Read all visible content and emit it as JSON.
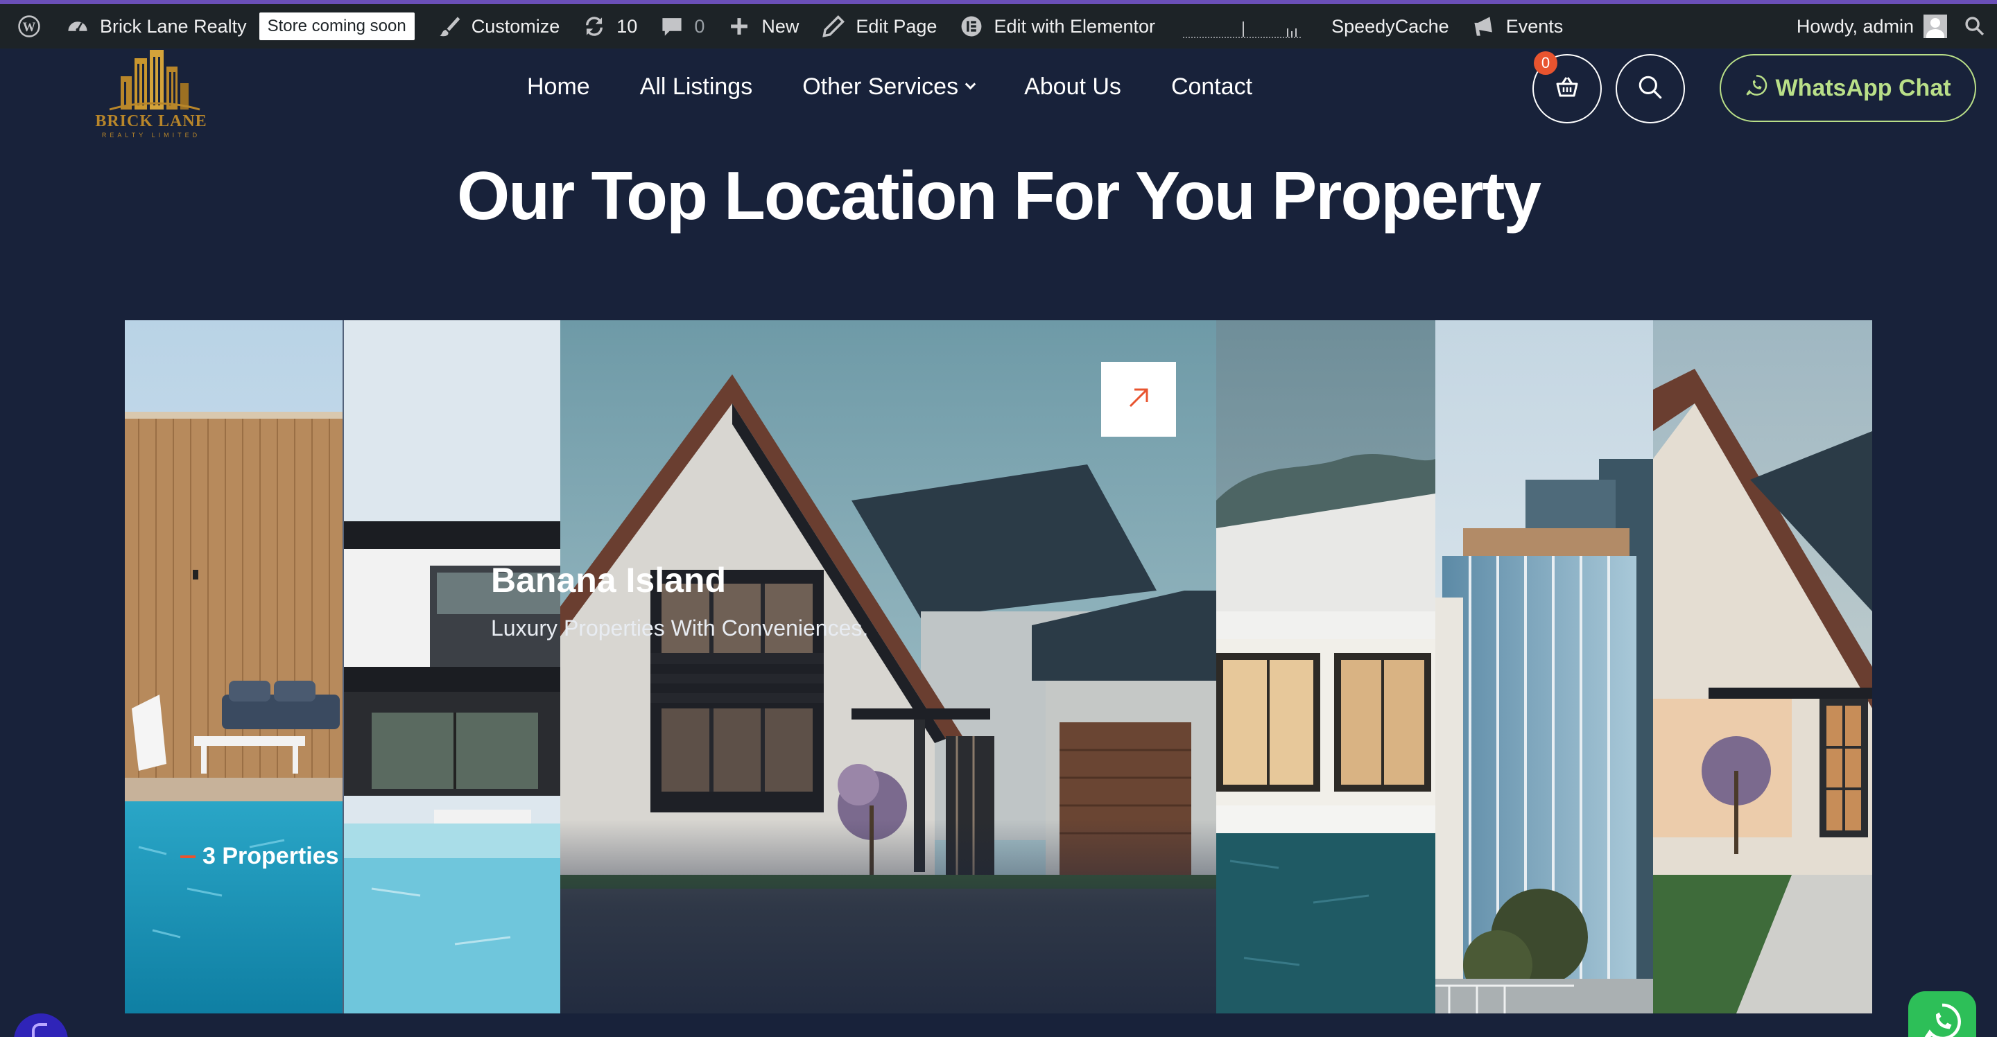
{
  "admin_bar": {
    "site_name": "Brick Lane Realty",
    "store_badge": "Store coming soon",
    "customize": "Customize",
    "updates_count": "10",
    "comments_count": "0",
    "new": "New",
    "edit_page": "Edit Page",
    "edit_elementor": "Edit with Elementor",
    "speedycache": "SpeedyCache",
    "events": "Events",
    "howdy": "Howdy, admin",
    "accent_color": "#6a4fb8"
  },
  "header": {
    "logo_name": "BRICK LANE",
    "logo_tagline": "REALTY LIMITED",
    "nav": [
      "Home",
      "All Listings",
      "Other Services",
      "About Us",
      "Contact"
    ],
    "cart_count": "0",
    "whatsapp_label": "WhatsApp Chat",
    "whatsapp_color": "#b9df88"
  },
  "section": {
    "title": "Our Top Location For You Property"
  },
  "featured_card": {
    "count": "3 Properties",
    "title": "Banana Island",
    "description": "Luxury Properties With Conveniences.",
    "accent_color": "#e8542f"
  },
  "icons": [
    "wordpress-icon",
    "dashboard-icon",
    "brush-icon",
    "refresh-icon",
    "comment-icon",
    "plus-icon",
    "pencil-icon",
    "elementor-icon",
    "megaphone-icon",
    "user-avatar-icon",
    "cart-icon",
    "search-icon",
    "whatsapp-icon",
    "arrow-up-right-icon"
  ]
}
